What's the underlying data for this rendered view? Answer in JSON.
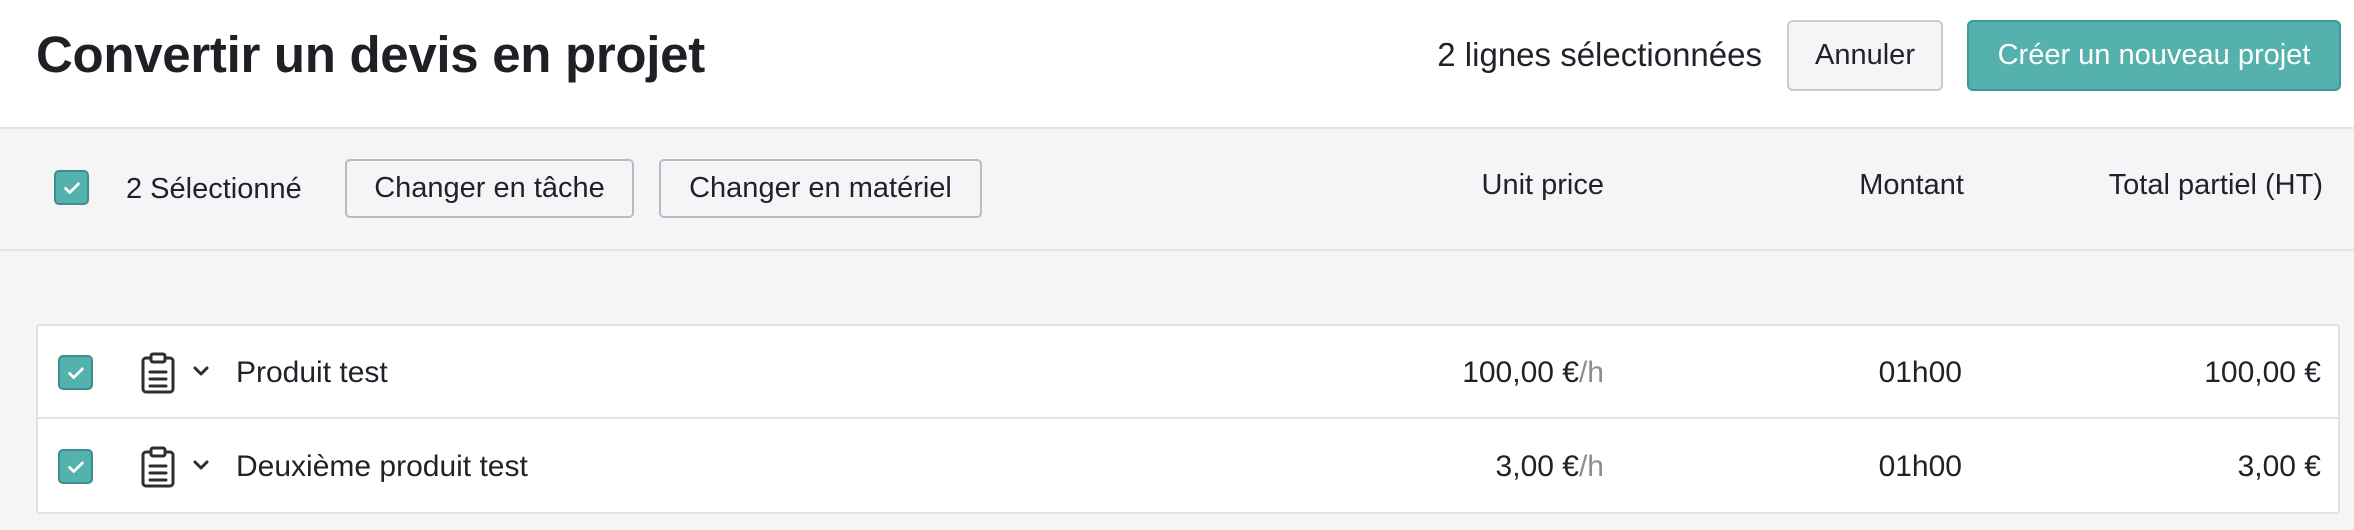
{
  "header": {
    "title": "Convertir un devis en projet",
    "selected_count": "2 lignes sélectionnées",
    "cancel_label": "Annuler",
    "create_label": "Créer un nouveau projet"
  },
  "toolbar": {
    "selected_label": "2 Sélectionné",
    "change_task_label": "Changer en tâche",
    "change_material_label": "Changer en matériel",
    "all_selected": true
  },
  "columns": {
    "unit_price": "Unit price",
    "amount": "Montant",
    "subtotal": "Total partiel (HT)"
  },
  "rows": [
    {
      "checked": true,
      "icon": "clipboard-icon",
      "name": "Produit test",
      "unit_price": "100,00 €",
      "unit_suffix": "/h",
      "amount": "01h00",
      "subtotal": "100,00 €"
    },
    {
      "checked": true,
      "icon": "clipboard-icon",
      "name": "Deuxième produit test",
      "unit_price": "3,00 €",
      "unit_suffix": "/h",
      "amount": "01h00",
      "subtotal": "3,00 €"
    }
  ],
  "colors": {
    "accent": "#55b1ae",
    "header_bg": "#ffffff",
    "body_bg": "#f5f5f7",
    "text": "#1f2228",
    "muted": "#8a8d94"
  }
}
